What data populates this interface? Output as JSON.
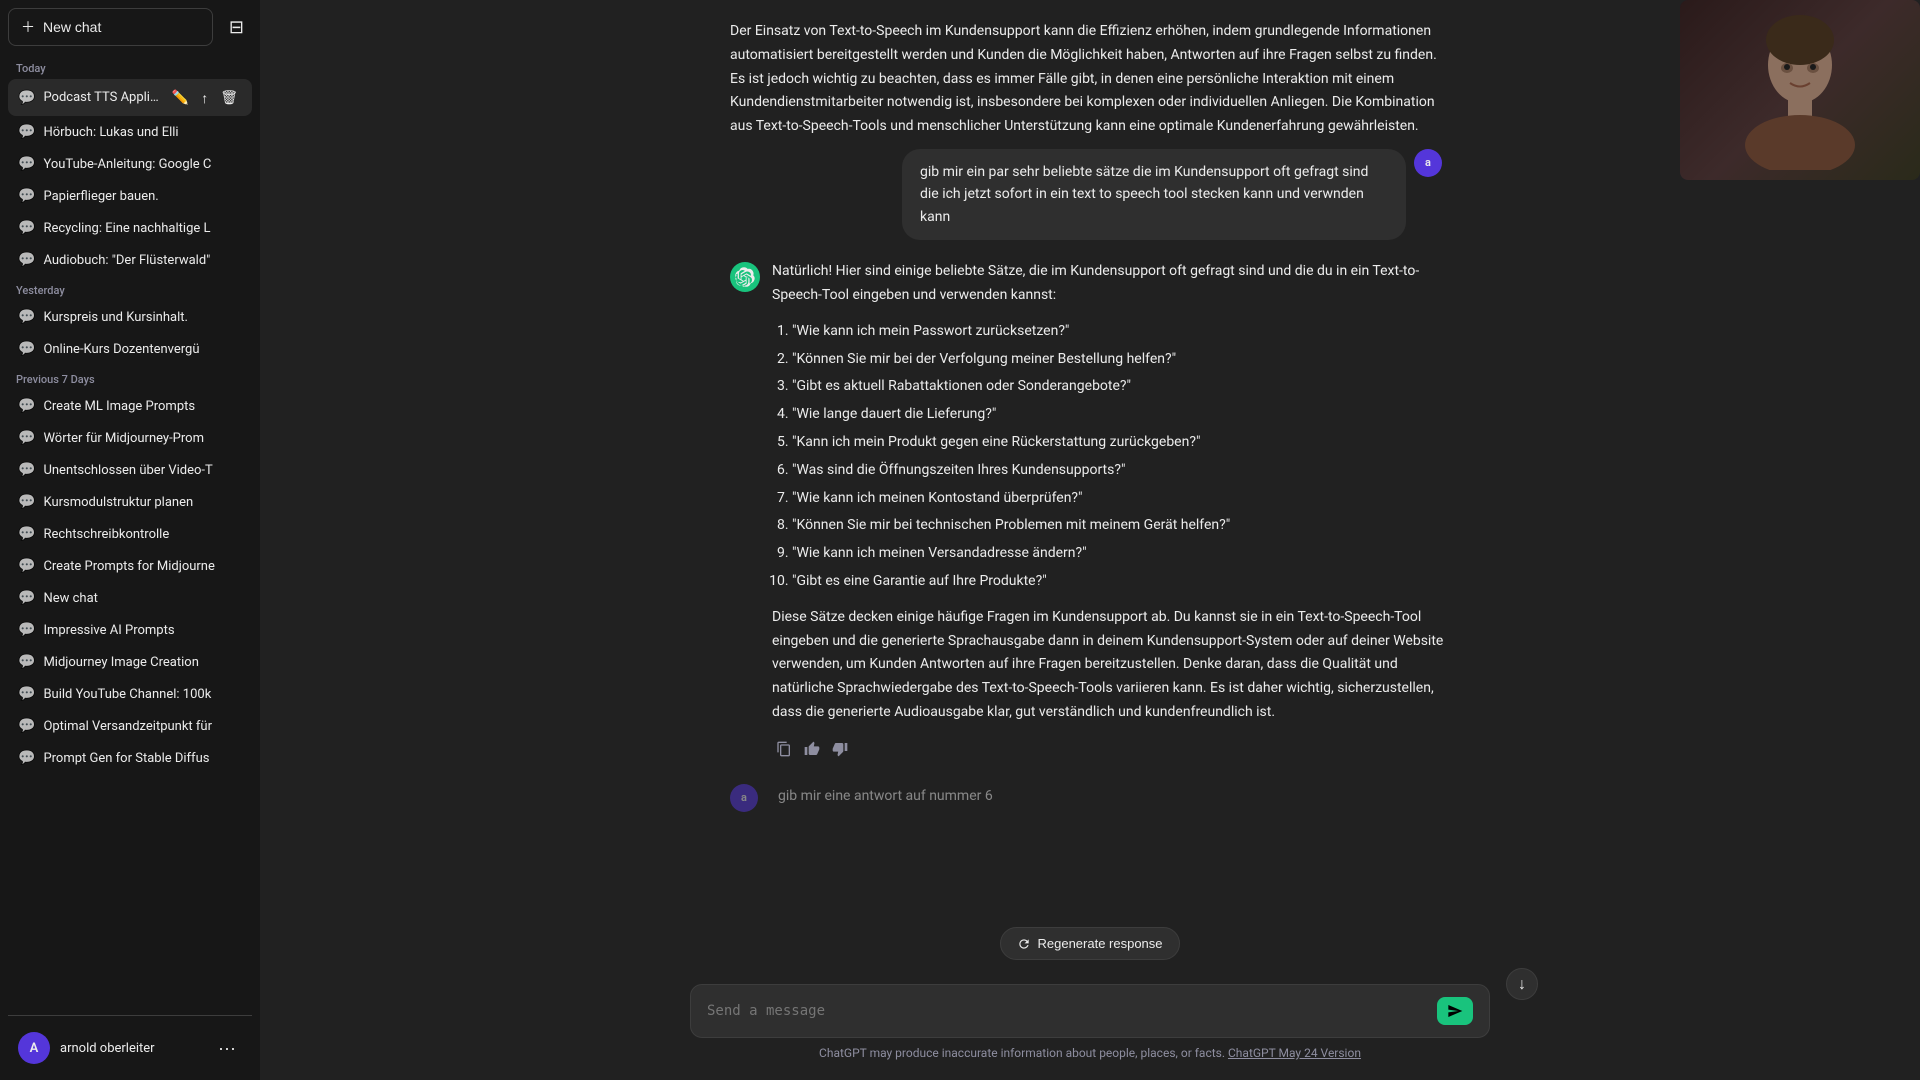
{
  "sidebar": {
    "new_chat_label": "New chat",
    "sections": [
      {
        "label": "Today",
        "items": [
          {
            "id": "podcast-tts",
            "text": "Podcast TTS Applica",
            "active": true
          },
          {
            "id": "hoerbuch",
            "text": "Hörbuch: Lukas und Elli"
          },
          {
            "id": "youtube-anleitung",
            "text": "YouTube-Anleitung: Google C"
          },
          {
            "id": "papierflieger",
            "text": "Papierflieger bauen."
          },
          {
            "id": "recycling",
            "text": "Recycling: Eine nachhaltige L"
          },
          {
            "id": "audiobuch",
            "text": "Audiobuch: \"Der Flüsterwald\""
          }
        ]
      },
      {
        "label": "Yesterday",
        "items": [
          {
            "id": "kurspreis",
            "text": "Kurspreis und Kursinhalt."
          },
          {
            "id": "online-kurs",
            "text": "Online-Kurs Dozentenvergü"
          }
        ]
      },
      {
        "label": "Previous 7 Days",
        "items": [
          {
            "id": "create-ml",
            "text": "Create ML Image Prompts"
          },
          {
            "id": "woerter",
            "text": "Wörter für Midjourney-Prom"
          },
          {
            "id": "unentschlossen",
            "text": "Unentschlossen über Video-T"
          },
          {
            "id": "kursmodulstruktur",
            "text": "Kursmodulstruktur planen"
          },
          {
            "id": "rechtschreibkontrolle",
            "text": "Rechtschreibkontrolle"
          },
          {
            "id": "create-prompts",
            "text": "Create Prompts for Midjourne"
          },
          {
            "id": "new-chat2",
            "text": "New chat"
          },
          {
            "id": "impressive-ai",
            "text": "Impressive AI Prompts"
          },
          {
            "id": "midjourney-image",
            "text": "Midjourney Image Creation"
          },
          {
            "id": "build-youtube",
            "text": "Build YouTube Channel: 100k"
          },
          {
            "id": "optimal-versand",
            "text": "Optimal Versandzeitpunkt für"
          },
          {
            "id": "prompt-gen",
            "text": "Prompt Gen for Stable Diffus"
          }
        ]
      }
    ],
    "user": {
      "name": "arnold oberleiter",
      "initials": "A"
    }
  },
  "top_message": {
    "text": "Der Einsatz von Text-to-Speech im Kundensupport kann die Effizienz erhöhen, indem grundlegende Informationen automatisiert bereitgestellt werden und Kunden die Möglichkeit haben, Antworten auf ihre Fragen selbst zu finden. Es ist jedoch wichtig zu beachten, dass es immer Fälle gibt, in denen eine persönliche Interaktion mit einem Kundendienstmitarbeiter notwendig ist, insbesondere bei komplexen oder individuellen Anliegen. Die Kombination aus Text-to-Speech-Tools und menschlicher Unterstützung kann eine optimale Kundenerfahrung gewährleisten."
  },
  "user_message": {
    "text": "gib mir ein par sehr beliebte sätze die im Kundensupport oft gefragt sind die ich jetzt sofort in ein text to speech tool stecken kann und verwnden kann",
    "avatar": "a"
  },
  "assistant_message": {
    "intro": "Natürlich! Hier sind einige beliebte Sätze, die im Kundensupport oft gefragt sind und die du in ein Text-to-Speech-Tool eingeben und verwenden kannst:",
    "list": [
      "\"Wie kann ich mein Passwort zurücksetzen?\"",
      "\"Können Sie mir bei der Verfolgung meiner Bestellung helfen?\"",
      "\"Gibt es aktuell Rabattaktionen oder Sonderangebote?\"",
      "\"Wie lange dauert die Lieferung?\"",
      "\"Kann ich mein Produkt gegen eine Rückerstattung zurückgeben?\"",
      "\"Was sind die Öffnungszeiten Ihres Kundensupports?\"",
      "\"Wie kann ich meinen Kontostand überprüfen?\"",
      "\"Können Sie mir bei technischen Problemen mit meinem Gerät helfen?\"",
      "\"Wie kann ich meinen Versandadresse ändern?\"",
      "\"Gibt es eine Garantie auf Ihre Produkte?\""
    ],
    "outro": "Diese Sätze decken einige häufige Fragen im Kundensupport ab. Du kannst sie in ein Text-to-Speech-Tool eingeben und die generierte Sprachausgabe dann in deinem Kundensupport-System oder auf deiner Website verwenden, um Kunden Antworten auf ihre Fragen bereitzustellen. Denke daran, dass die Qualität und natürliche Sprachwiedergabe des Text-to-Speech-Tools variieren kann. Es ist daher wichtig, sicherzustellen, dass die generierte Audioausgabe klar, gut verständlich und kundenfreundlich ist.",
    "actions": {
      "copy": "📋",
      "thumbs_up": "👍",
      "thumbs_down": "👎"
    }
  },
  "truncated_message": {
    "text": "gib mir eine antwort auf nummer 6"
  },
  "input": {
    "placeholder": "Send a message",
    "regenerate_label": "Regenerate response"
  },
  "disclaimer": {
    "text": "ChatGPT may produce inaccurate information about people, places, or facts.",
    "link_text": "ChatGPT May 24 Version"
  }
}
